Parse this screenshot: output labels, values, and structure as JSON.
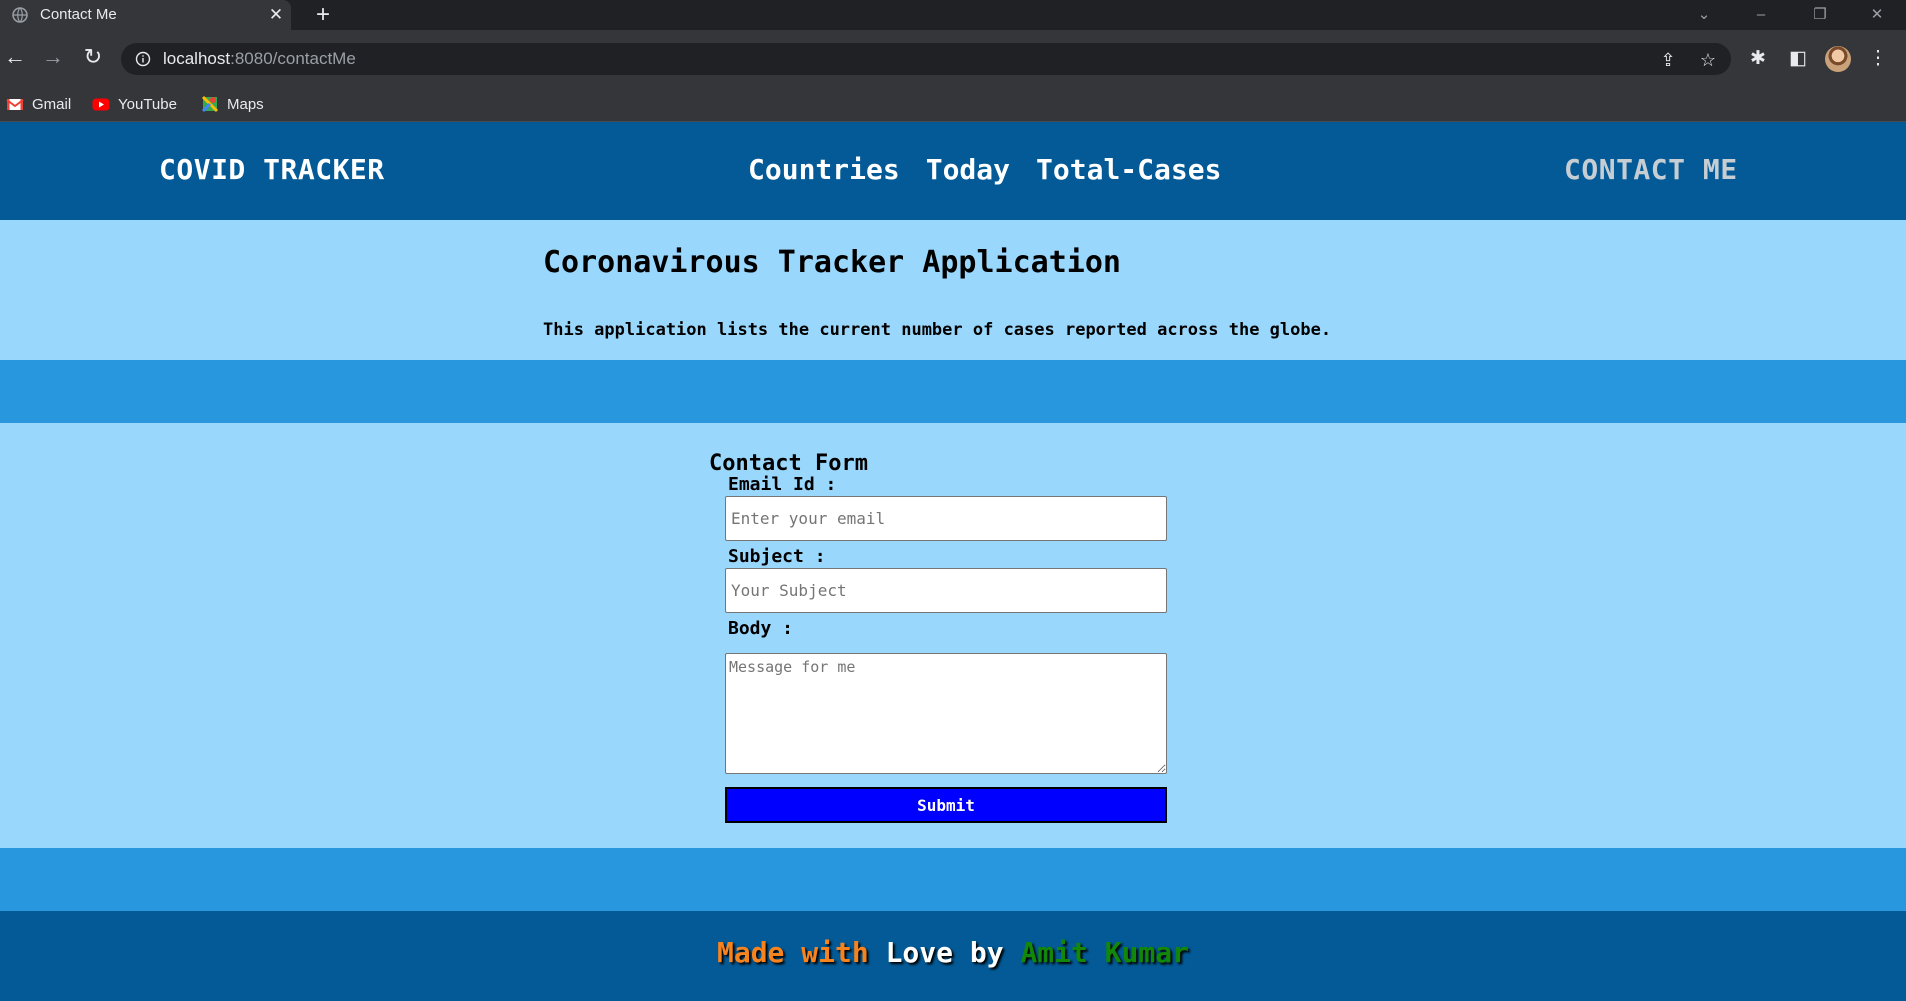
{
  "browser": {
    "tab": {
      "title": "Contact Me",
      "favicon": "globe-icon"
    },
    "address_bar": {
      "host": "localhost",
      "path": ":8080/contactMe"
    },
    "bookmarks": [
      {
        "label": "Gmail",
        "icon": "gmail-icon"
      },
      {
        "label": "YouTube",
        "icon": "youtube-icon"
      },
      {
        "label": "Maps",
        "icon": "maps-icon"
      }
    ]
  },
  "navbar": {
    "brand": "COVID TRACKER",
    "links": [
      "Countries",
      "Today",
      "Total-Cases"
    ],
    "contact": "CONTACT ME"
  },
  "hero": {
    "title": "Coronavirous Tracker Application",
    "description": "This application lists the current number of cases reported across the globe."
  },
  "contact_form": {
    "title": "Contact Form",
    "email_label": "Email Id :",
    "email_placeholder": "Enter your email",
    "subject_label": "Subject :",
    "subject_placeholder": "Your Subject",
    "body_label": "Body :",
    "body_placeholder": "Message for me",
    "submit_label": "Submit"
  },
  "footer": {
    "part1": "Made with",
    "part2": "Love",
    "part3": "by",
    "part4": "Amit Kumar"
  },
  "colors": {
    "navbar": "#035a96",
    "light_section": "#9ad7fc",
    "band": "#2997dd",
    "submit": "#0000ff",
    "footer_orange": "#f7831f",
    "footer_green": "#138808"
  }
}
